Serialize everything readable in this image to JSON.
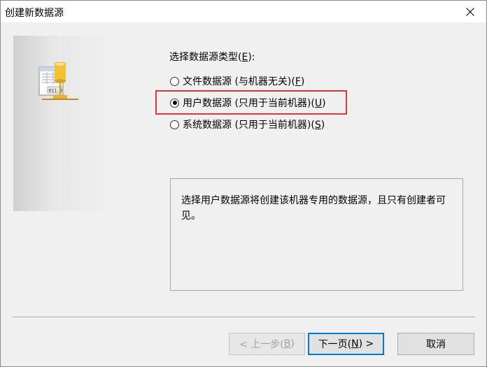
{
  "window": {
    "title": "创建新数据源"
  },
  "section": {
    "label_prefix": "选择数据源类型(",
    "label_key": "E",
    "label_suffix": "):"
  },
  "options": [
    {
      "label_prefix": "文件数据源 (与机器无关)(",
      "key": "F",
      "label_suffix": ")",
      "checked": false
    },
    {
      "label_prefix": "用户数据源 (只用于当前机器)(",
      "key": "U",
      "label_suffix": ")",
      "checked": true
    },
    {
      "label_prefix": "系统数据源 (只用于当前机器)(",
      "key": "S",
      "label_suffix": ")",
      "checked": false
    }
  ],
  "description": "选择用户数据源将创建该机器专用的数据源，且只有创建者可见。",
  "buttons": {
    "back": {
      "prefix": "< 上一步(",
      "key": "B",
      "suffix": ")",
      "enabled": false
    },
    "next": {
      "prefix": "下一页(",
      "key": "N",
      "suffix": ") >",
      "enabled": true
    },
    "cancel": {
      "label": "取消"
    }
  },
  "icons": {
    "close": "close-icon",
    "datasource": "data-source-icon"
  },
  "colors": {
    "highlight": "#e0353b",
    "default_button_border": "#0078d7"
  }
}
